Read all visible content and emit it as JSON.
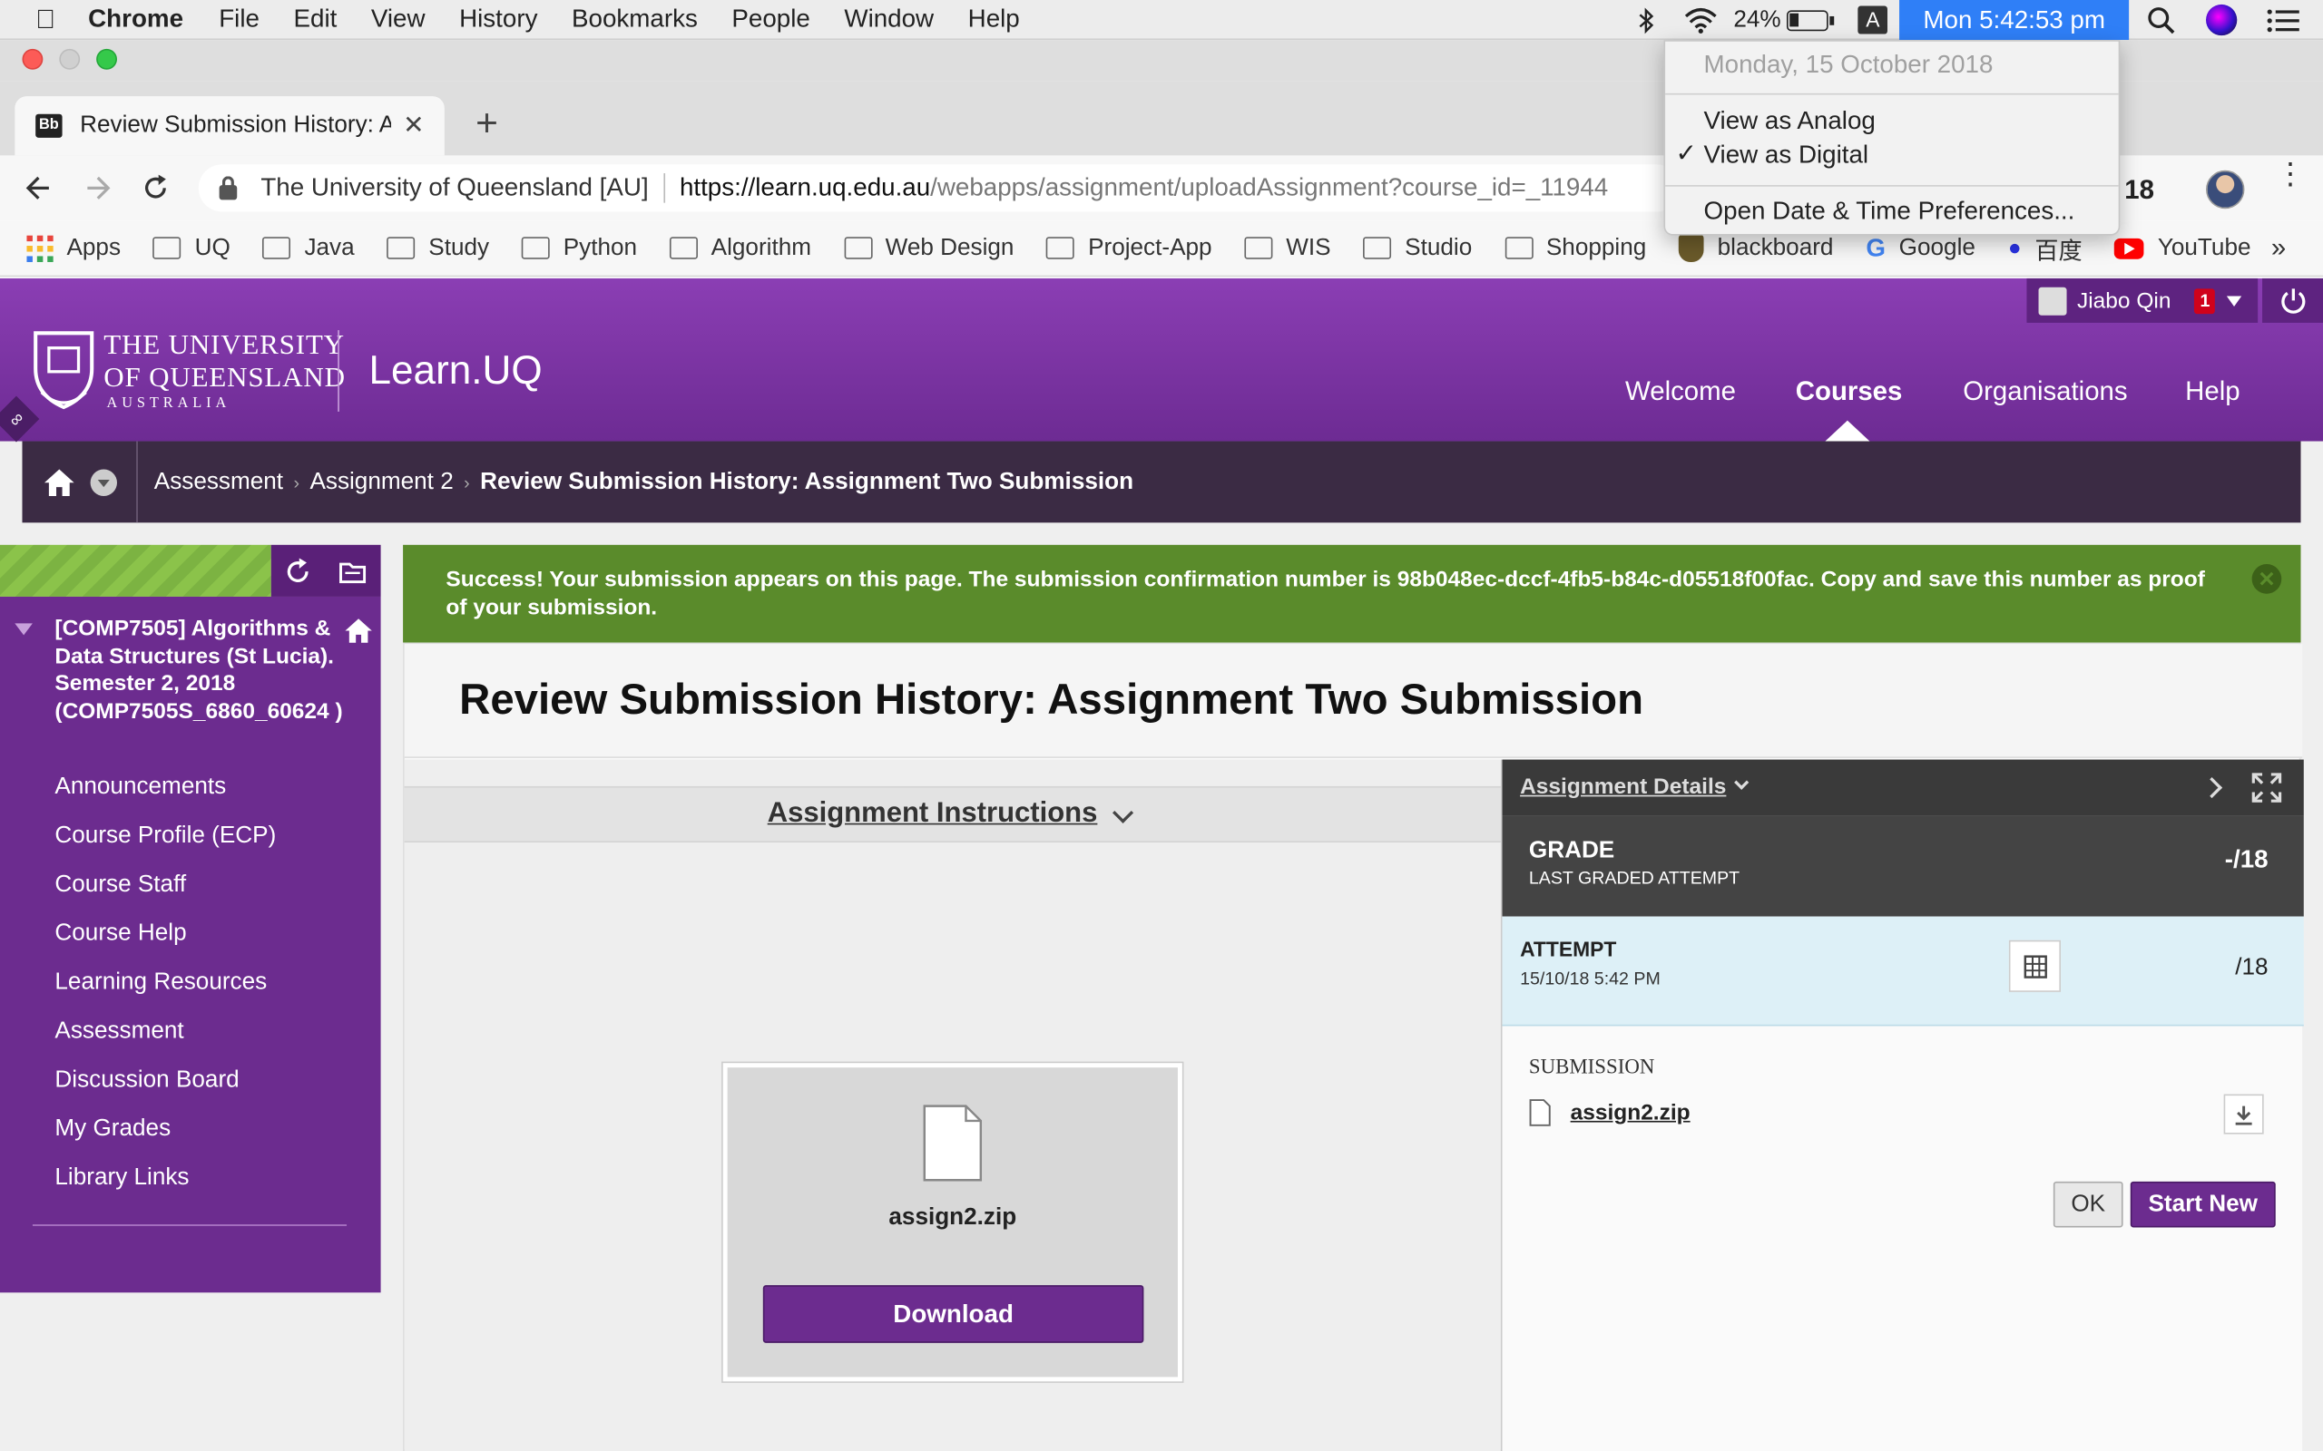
{
  "menubar": {
    "app": "Chrome",
    "items": [
      "File",
      "Edit",
      "View",
      "History",
      "Bookmarks",
      "People",
      "Window",
      "Help"
    ],
    "battery": "24%",
    "input": "A",
    "clock": "Mon 5:42:53 pm"
  },
  "clock_menu": {
    "date": "Monday, 15 October 2018",
    "analog": "View as Analog",
    "digital": "View as Digital",
    "prefs": "Open Date & Time Preferences..."
  },
  "tab": {
    "favicon": "Bb",
    "title": "Review Submission History: As"
  },
  "omnibox": {
    "site": "The University of Queensland [AU]",
    "url_host": "https://learn.uq.edu.au",
    "url_path": "/webapps/assignment/uploadAssignment?course_id=_11944",
    "ext_text": "18"
  },
  "bookmarks": {
    "apps": "Apps",
    "items": [
      "UQ",
      "Java",
      "Study",
      "Python",
      "Algorithm",
      "Web Design",
      "Project-App",
      "WIS",
      "Studio",
      "Shopping"
    ],
    "blackboard": "blackboard",
    "google": "Google",
    "baidu": "百度",
    "youtube": "YouTube",
    "more": "»"
  },
  "header": {
    "uni_line1": "THE UNIVERSITY",
    "uni_line2": "OF QUEENSLAND",
    "uni_line3": "AUSTRALIA",
    "product": "Learn.UQ",
    "user": "Jiabo Qin",
    "notif": "1",
    "nav": [
      "Welcome",
      "Courses",
      "Organisations",
      "Help"
    ]
  },
  "breadcrumb": [
    "Assessment",
    "Assignment 2",
    "Review Submission History: Assignment Two Submission"
  ],
  "sidebar": {
    "course": "[COMP7505] Algorithms & Data Structures (St Lucia). Semester 2, 2018 (COMP7505S_6860_60624 )",
    "items": [
      "Announcements",
      "Course Profile (ECP)",
      "Course Staff",
      "Course Help",
      "Learning Resources",
      "Assessment",
      "Discussion Board",
      "My Grades",
      "Library Links"
    ]
  },
  "success": {
    "text": "Success! Your submission appears on this page. The submission confirmation number is 98b048ec-dccf-4fb5-b84c-d05518f00fac. Copy and save this number as proof of your submission."
  },
  "main": {
    "title": "Review Submission History: Assignment Two Submission",
    "instructions": "Assignment Instructions",
    "file_name": "assign2.zip",
    "download": "Download"
  },
  "details": {
    "header": "Assignment Details",
    "grade_label": "GRADE",
    "grade_sub": "LAST GRADED ATTEMPT",
    "grade_value": "-/18",
    "attempt_label": "ATTEMPT",
    "attempt_date": "15/10/18 5:42 PM",
    "attempt_value": "/18",
    "submission_label": "SUBMISSION",
    "submission_file": "assign2.zip",
    "ok": "OK",
    "start_new": "Start New"
  },
  "colors": {
    "purple": "#6c2c8f",
    "success_green": "#5a8b2b",
    "clock_blue": "#2f7ff7"
  }
}
